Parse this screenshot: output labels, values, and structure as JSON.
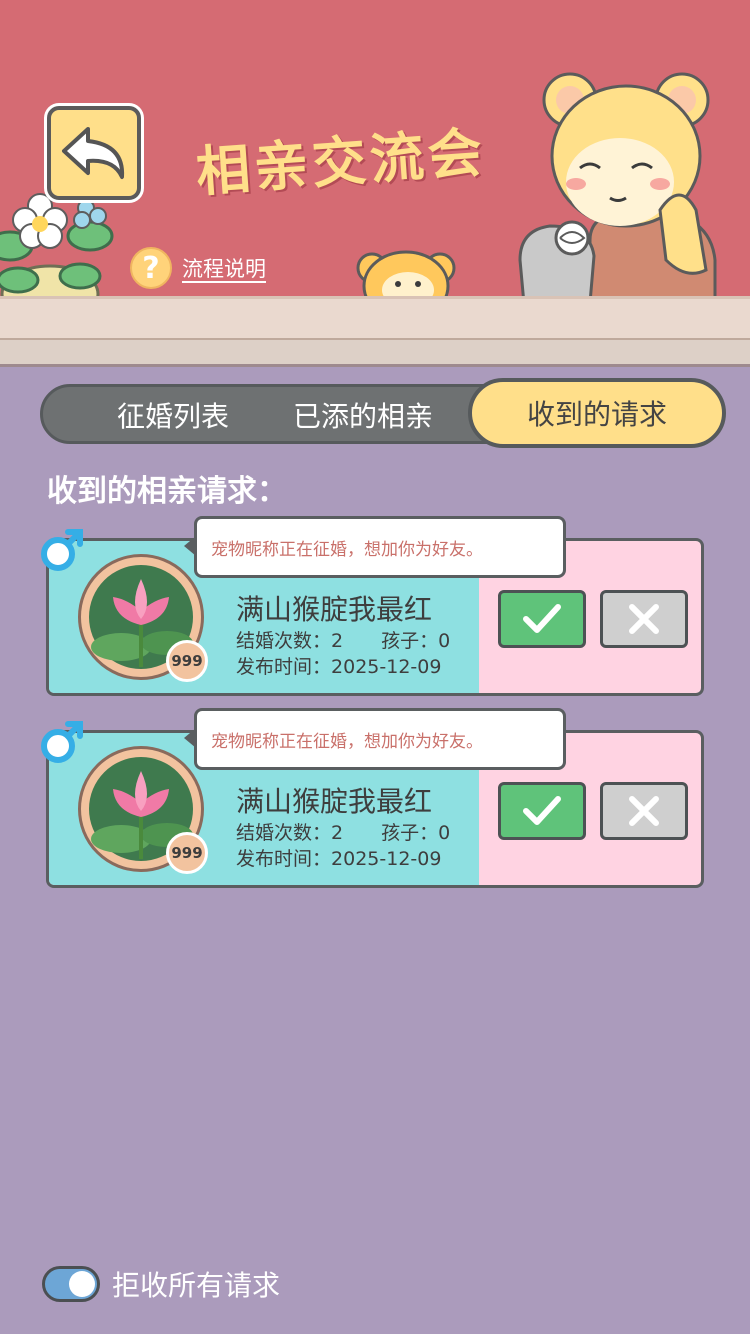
{
  "header": {
    "title": "相亲交流会",
    "help_label": "流程说明",
    "help_glyph": "?"
  },
  "tabs": [
    {
      "label": "征婚列表",
      "active": false
    },
    {
      "label": "已添的相亲",
      "active": false
    },
    {
      "label": "收到的请求",
      "active": true
    }
  ],
  "section_title": "收到的相亲请求：",
  "requests": [
    {
      "message": "宠物昵称正在征婚，想加你为好友。",
      "nickname": "满山猴腚我最红",
      "marriage_label": "结婚次数：",
      "marriage_count": "2",
      "children_label": "孩子：",
      "children_count": "0",
      "date_label": "发布时间：",
      "date": "2025-12-09",
      "level": "999",
      "gender_icon": "male-icon"
    },
    {
      "message": "宠物昵称正在征婚，想加你为好友。",
      "nickname": "满山猴腚我最红",
      "marriage_label": "结婚次数：",
      "marriage_count": "2",
      "children_label": "孩子：",
      "children_count": "0",
      "date_label": "发布时间：",
      "date": "2025-12-09",
      "level": "999",
      "gender_icon": "male-icon"
    }
  ],
  "footer": {
    "reject_all_label": "拒收所有请求",
    "reject_all_enabled": true
  },
  "colors": {
    "header_bg": "#d56b73",
    "page_bg": "#ab9bbc",
    "accent_yellow": "#ffdf8a",
    "card_cyan": "#8ee0e1",
    "card_pink": "#ffd3e2",
    "accept_green": "#5fc37a",
    "reject_gray": "#cfcfcf",
    "male_blue": "#35aee6"
  }
}
